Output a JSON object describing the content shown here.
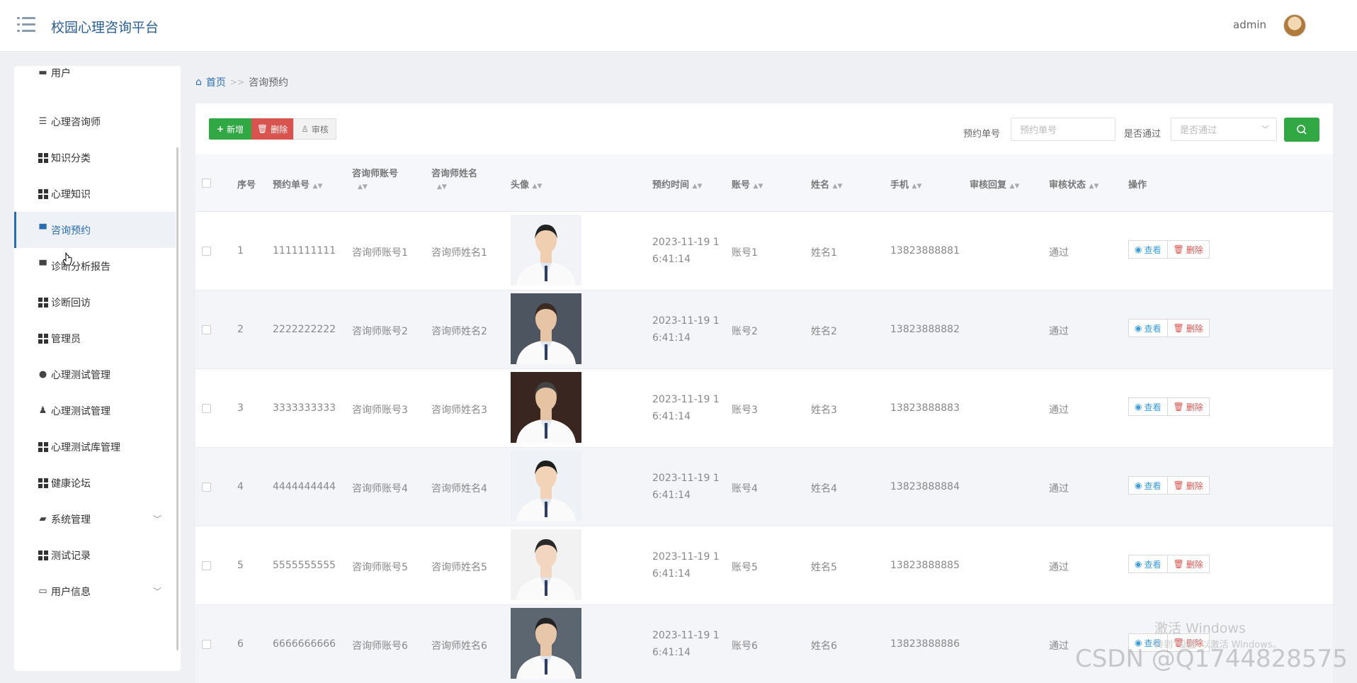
{
  "header": {
    "title": "校园心理咨询平台",
    "user": "admin"
  },
  "sidebar": {
    "items": [
      {
        "label": "用户",
        "icon": "user-card-icon"
      },
      {
        "label": "心理咨询师",
        "icon": "sliders-icon"
      },
      {
        "label": "知识分类",
        "icon": "grid-icon"
      },
      {
        "label": "心理知识",
        "icon": "grid-icon"
      },
      {
        "label": "咨询预约",
        "icon": "monitor-icon"
      },
      {
        "label": "诊断分析报告",
        "icon": "flag-icon"
      },
      {
        "label": "诊断回访",
        "icon": "grid-icon"
      },
      {
        "label": "管理员",
        "icon": "grid-icon"
      },
      {
        "label": "心理测试管理",
        "icon": "lightbulb-icon"
      },
      {
        "label": "心理测试管理",
        "icon": "stamp-icon"
      },
      {
        "label": "心理测试库管理",
        "icon": "grid-icon"
      },
      {
        "label": "健康论坛",
        "icon": "grid-icon"
      },
      {
        "label": "系统管理",
        "icon": "ticket-icon"
      },
      {
        "label": "测试记录",
        "icon": "grid-icon"
      },
      {
        "label": "用户信息",
        "icon": "card-icon"
      }
    ]
  },
  "breadcrumb": {
    "home": "首页",
    "sep": ">>",
    "current": "咨询预约"
  },
  "toolbar": {
    "add": "新增",
    "delete": "删除",
    "audit": "审核"
  },
  "filters": {
    "order_label": "预约单号",
    "order_placeholder": "预约单号",
    "passed_label": "是否通过",
    "passed_placeholder": "是否通过"
  },
  "table": {
    "headers": {
      "index": "序号",
      "order_no": "预约单号",
      "counselor_account": "咨询师账号",
      "counselor_name": "咨询师姓名",
      "avatar": "头像",
      "time": "预约时间",
      "account": "账号",
      "name": "姓名",
      "phone": "手机",
      "reply": "审核回复",
      "status": "审核状态",
      "ops": "操作"
    },
    "view_label": "查看",
    "delete_label": "删除",
    "rows": [
      {
        "index": "1",
        "order_no": "1111111111",
        "counselor_account": "咨询师账号1",
        "counselor_name": "咨询师姓名1",
        "time_a": "2023-11-19 1",
        "time_b": "6:41:14",
        "account": "账号1",
        "name": "姓名1",
        "phone": "13823888881",
        "reply": "",
        "status": "通过"
      },
      {
        "index": "2",
        "order_no": "2222222222",
        "counselor_account": "咨询师账号2",
        "counselor_name": "咨询师姓名2",
        "time_a": "2023-11-19 1",
        "time_b": "6:41:14",
        "account": "账号2",
        "name": "姓名2",
        "phone": "13823888882",
        "reply": "",
        "status": "通过"
      },
      {
        "index": "3",
        "order_no": "3333333333",
        "counselor_account": "咨询师账号3",
        "counselor_name": "咨询师姓名3",
        "time_a": "2023-11-19 1",
        "time_b": "6:41:14",
        "account": "账号3",
        "name": "姓名3",
        "phone": "13823888883",
        "reply": "",
        "status": "通过"
      },
      {
        "index": "4",
        "order_no": "4444444444",
        "counselor_account": "咨询师账号4",
        "counselor_name": "咨询师姓名4",
        "time_a": "2023-11-19 1",
        "time_b": "6:41:14",
        "account": "账号4",
        "name": "姓名4",
        "phone": "13823888884",
        "reply": "",
        "status": "通过"
      },
      {
        "index": "5",
        "order_no": "5555555555",
        "counselor_account": "咨询师账号5",
        "counselor_name": "咨询师姓名5",
        "time_a": "2023-11-19 1",
        "time_b": "6:41:14",
        "account": "账号5",
        "name": "姓名5",
        "phone": "13823888885",
        "reply": "",
        "status": "通过"
      },
      {
        "index": "6",
        "order_no": "6666666666",
        "counselor_account": "咨询师账号6",
        "counselor_name": "咨询师姓名6",
        "time_a": "2023-11-19 1",
        "time_b": "6:41:14",
        "account": "账号6",
        "name": "姓名6",
        "phone": "13823888886",
        "reply": "",
        "status": "通过"
      }
    ]
  },
  "watermark": {
    "activate_title": "激活 Windows",
    "activate_sub": "转到“设置”以激活 Windows。",
    "csdn": "CSDN @Q1744828575"
  },
  "colors": {
    "brand": "#2b5e92",
    "accent": "#2b6cb0",
    "green": "#32a845",
    "red": "#d9534f"
  }
}
